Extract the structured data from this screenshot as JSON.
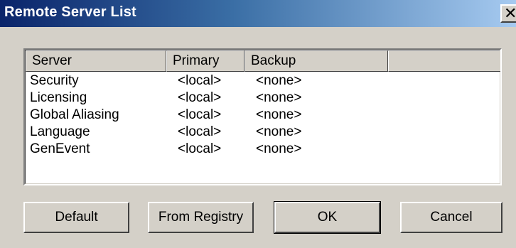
{
  "window": {
    "title": "Remote Server List",
    "close_glyph": "✕"
  },
  "list": {
    "columns": [
      "Server",
      "Primary",
      "Backup",
      ""
    ],
    "rows": [
      {
        "server": "Security",
        "primary": "<local>",
        "backup": "<none>"
      },
      {
        "server": "Licensing",
        "primary": "<local>",
        "backup": "<none>"
      },
      {
        "server": "Global Aliasing",
        "primary": "<local>",
        "backup": "<none>"
      },
      {
        "server": "Language",
        "primary": "<local>",
        "backup": "<none>"
      },
      {
        "server": "GenEvent",
        "primary": "<local>",
        "backup": "<none>"
      }
    ]
  },
  "buttons": {
    "default_label": "Default",
    "from_registry_label": "From Registry",
    "ok_label": "OK",
    "cancel_label": "Cancel"
  },
  "colors": {
    "title_gradient_start": "#0a246a",
    "title_gradient_end": "#a6caf0",
    "face": "#d4d0c8",
    "list_background": "#ffffff"
  },
  "icons": {
    "close": "close-icon"
  }
}
